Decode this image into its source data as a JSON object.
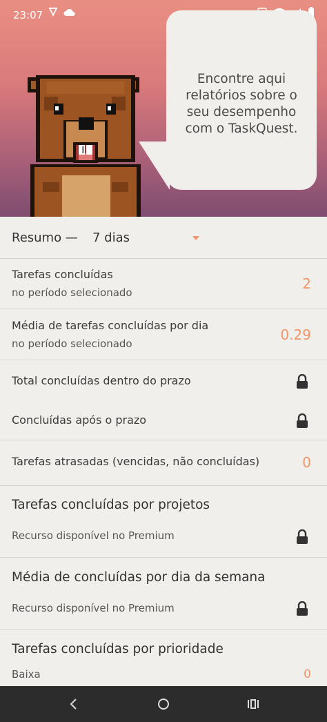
{
  "status_bar": {
    "time": "23:07"
  },
  "hero": {
    "bubble_text": "Encontre aqui relatórios sobre o seu desempenho com o TaskQuest."
  },
  "summary": {
    "label": "Resumo —",
    "value": "7 dias"
  },
  "stats": {
    "completed": {
      "label": "Tarefas concluídas",
      "sub": "no período selecionado",
      "value": "2"
    },
    "avg_per_day": {
      "label": "Média de tarefas concluídas por dia",
      "sub": "no período selecionado",
      "value": "0.29"
    },
    "on_time": {
      "label": "Total concluídas dentro do prazo"
    },
    "after_deadline": {
      "label": "Concluídas após o prazo"
    },
    "overdue": {
      "label": "Tarefas atrasadas (vencidas, não concluídas)",
      "value": "0"
    }
  },
  "by_project": {
    "title": "Tarefas concluídas por projetos",
    "sub": "Recurso disponível no Premium"
  },
  "by_weekday": {
    "title": "Média de concluídas por dia da semana",
    "sub": "Recurso disponível no Premium"
  },
  "by_priority": {
    "title": "Tarefas concluídas por prioridade",
    "rows": [
      {
        "label": "Baixa",
        "value": "0"
      }
    ]
  },
  "colors": {
    "accent": "#f0956a",
    "background": "#f1efec",
    "divider": "#d5d2cf"
  }
}
